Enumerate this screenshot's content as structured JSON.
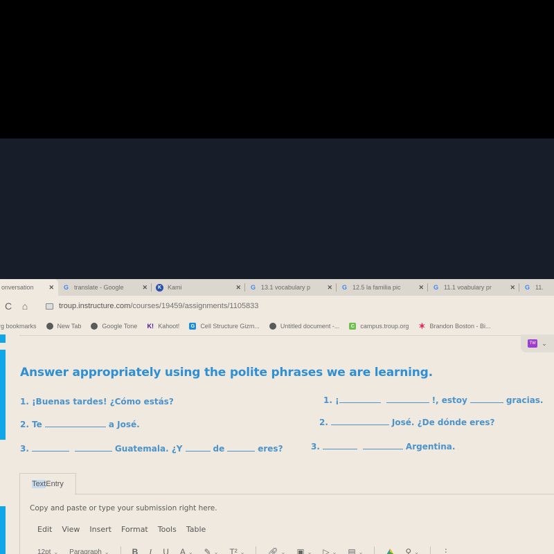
{
  "browser": {
    "tabs": [
      {
        "title": "onversation",
        "icon": "document-icon",
        "active": true
      },
      {
        "title": "translate - Google",
        "icon": "google-icon",
        "active": false
      },
      {
        "title": "Kami",
        "icon": "kami-icon",
        "active": false
      },
      {
        "title": "13.1 vocabulary p",
        "icon": "google-icon",
        "active": false
      },
      {
        "title": "12.5 la familia pic",
        "icon": "google-icon",
        "active": false
      },
      {
        "title": "11.1 voabulary pr",
        "icon": "google-icon",
        "active": false
      },
      {
        "title": "11.",
        "icon": "google-icon",
        "active": false
      }
    ],
    "close_glyph": "✕",
    "reload_glyph": "C",
    "home_glyph": "⌂",
    "url_host": "troup.instructure.com",
    "url_path": "/courses/19459/assignments/1105833",
    "bookmarks": [
      {
        "label": "rg bookmarks",
        "icon": "folder-icon"
      },
      {
        "label": "New Tab",
        "icon": "globe-icon"
      },
      {
        "label": "Google Tone",
        "icon": "globe-icon"
      },
      {
        "label": "Kahoot!",
        "icon": "kahoot-icon"
      },
      {
        "label": "Cell Structure Gizm...",
        "icon": "gizmos-icon"
      },
      {
        "label": "Untitled document -...",
        "icon": "globe-icon"
      },
      {
        "label": "campus.troup.org",
        "icon": "campus-icon"
      },
      {
        "label": "Brandon Boston - Bi...",
        "icon": "star-icon"
      }
    ]
  },
  "extension": {
    "label": "TW",
    "chevron": "⌄"
  },
  "worksheet": {
    "title": "Answer appropriately using the polite phrases we are learning.",
    "left": {
      "l1": "1. ¡Buenas tardes! ¿Cómo estás?",
      "l2a": "2. Te",
      "l2b": "a José.",
      "l3a": "3.",
      "l3b": "Guatemala. ¿Y",
      "l3c": "de",
      "l3d": "eres?"
    },
    "right": {
      "r1a": "1. ¡",
      "r1b": "!, estoy",
      "r1c": "gracias.",
      "r2a": "2.",
      "r2b": "José. ¿De dónde eres?",
      "r3a": "3.",
      "r3b": "Argentina."
    }
  },
  "submission": {
    "tab_label_highlight": "Text",
    "tab_label_rest": " Entry",
    "hint": "Copy and paste or type your submission right here.",
    "menu": [
      "Edit",
      "View",
      "Insert",
      "Format",
      "Tools",
      "Table"
    ],
    "toolbar": {
      "font_size": "12pt",
      "block": "Paragraph",
      "bold": "B",
      "italic": "I",
      "underline": "U",
      "text_color": "A",
      "highlight": "✎",
      "superscript": "T²",
      "chevron": "⌄",
      "more": "⋮"
    }
  }
}
